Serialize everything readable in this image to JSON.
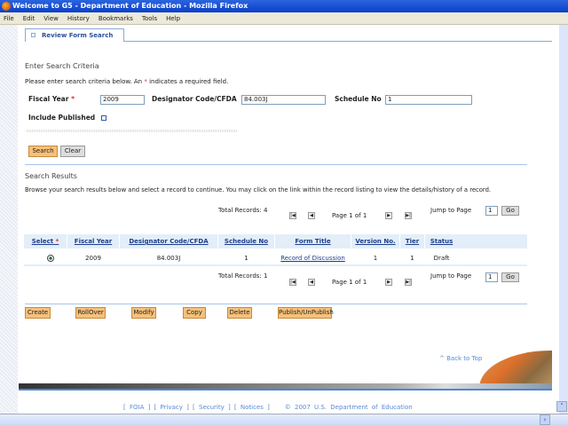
{
  "window": {
    "title": "Welcome to G5 - Department of Education - Mozilla Firefox"
  },
  "menu": [
    "File",
    "Edit",
    "View",
    "History",
    "Bookmarks",
    "Tools",
    "Help"
  ],
  "tab": {
    "label": "Review Form Search"
  },
  "criteria": {
    "heading": "Enter Search Criteria",
    "instructions_pre": "Please enter search criteria below. An ",
    "instructions_star": "*",
    "instructions_post": " indicates a required field.",
    "fiscal_year_label": "Fiscal Year",
    "fiscal_year_value": "2009",
    "designator_label": "Designator Code/CFDA",
    "designator_value": "84.003J",
    "schedule_label": "Schedule No",
    "schedule_value": "1",
    "include_published_label": "Include Published",
    "include_published_checked": false,
    "search_label": "Search",
    "clear_label": "Clear"
  },
  "results": {
    "heading": "Search Results",
    "instructions": "Browse your search results below and select a record to continue. You may click on the link within the record listing to view the details/history of a record.",
    "pager_top": {
      "total": "Total Records: 4",
      "page": "Page 1 of 1",
      "jump_label": "Jump to Page",
      "jump_value": "1",
      "go": "Go"
    },
    "pager_bottom": {
      "total": "Total Records: 1",
      "page": "Page 1 of 1",
      "jump_label": "Jump to Page",
      "jump_value": "1",
      "go": "Go"
    },
    "columns": [
      "Select",
      "Fiscal Year",
      "Designator Code/CFDA",
      "Schedule No",
      "Form Title",
      "Version No.",
      "Tier",
      "Status"
    ],
    "rows": [
      {
        "selected": true,
        "fiscal_year": "2009",
        "designator": "84.003J",
        "schedule": "1",
        "form_title": "Record of Discussion",
        "version": "1",
        "tier": "1",
        "status": "Draft"
      }
    ]
  },
  "actions": [
    "Create",
    "RollOver",
    "Modify",
    "Copy",
    "Delete",
    "Publish/UnPublish"
  ],
  "back_to_top": "^ Back to Top",
  "footer": {
    "links": [
      "FOIA",
      "Privacy",
      "Security",
      "Notices"
    ],
    "copyright": "© 2007 U.S. Department of Education"
  }
}
